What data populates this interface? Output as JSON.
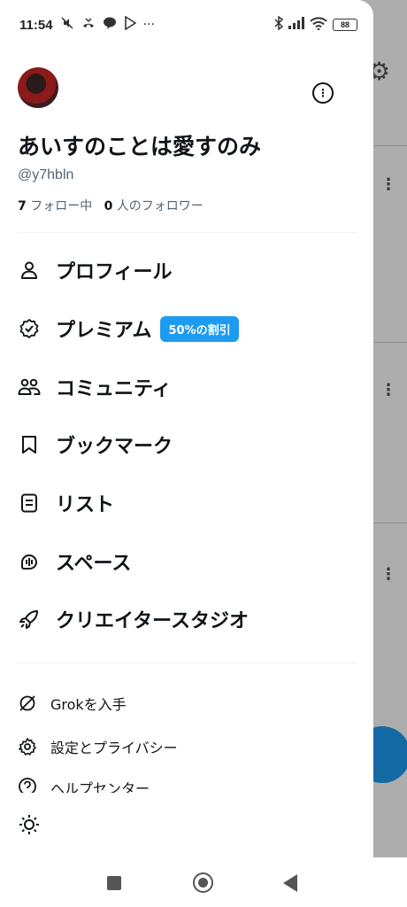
{
  "status_bar": {
    "time": "11:54",
    "battery": "88",
    "left_icons": [
      "mute-icon",
      "missed-call-icon",
      "line-icon",
      "play-store-icon",
      "more-icon"
    ],
    "right_icons": [
      "bluetooth-icon",
      "signal-icon",
      "wifi-icon"
    ],
    "more_dots": "···"
  },
  "profile": {
    "display_name": "あいすのことは愛すのみ",
    "handle": "@y7hbln",
    "following_count": "7",
    "following_label": "フォロー中",
    "followers_count": "0",
    "followers_label": "人のフォロワー",
    "more_icon": "⋮"
  },
  "menu": {
    "items": [
      {
        "label": "プロフィール",
        "icon": "person-icon"
      },
      {
        "label": "プレミアム",
        "icon": "verified-icon",
        "badge": "50%の割引"
      },
      {
        "label": "コミュニティ",
        "icon": "communities-icon"
      },
      {
        "label": "ブックマーク",
        "icon": "bookmark-icon"
      },
      {
        "label": "リスト",
        "icon": "list-icon"
      },
      {
        "label": "スペース",
        "icon": "spaces-icon"
      },
      {
        "label": "クリエイタースタジオ",
        "icon": "rocket-icon"
      }
    ]
  },
  "secondary": {
    "items": [
      {
        "label": "Grokを入手",
        "icon": "grok-icon"
      },
      {
        "label": "設定とプライバシー",
        "icon": "gear-icon"
      },
      {
        "label": "ヘルプセンター",
        "icon": "help-icon"
      }
    ]
  },
  "theme_toggle": {
    "icon": "sun-icon"
  },
  "accent": {
    "primary": "#1d9bf0",
    "text": "#0f1419",
    "muted": "#536471"
  }
}
